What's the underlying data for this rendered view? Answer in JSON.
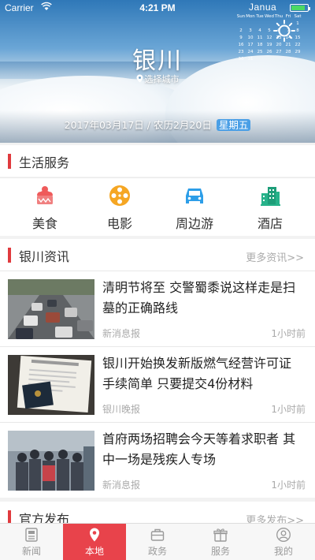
{
  "status": {
    "carrier": "Carrier",
    "time": "4:21 PM",
    "battery_level": 0.85
  },
  "hero": {
    "city": "银川",
    "choose_city": "选择城市",
    "date": "2017年03月17日",
    "lunar": "农历2月20日",
    "weekday": "星期五",
    "calendar": {
      "month": "Janua",
      "weekdays": [
        "Sun",
        "Mon",
        "Tue",
        "Wed",
        "Thu",
        "Fri",
        "Sat"
      ],
      "days": [
        "",
        "",
        "",
        "",
        "",
        "",
        "1",
        "2",
        "3",
        "4",
        "5",
        "6",
        "7",
        "8",
        "9",
        "10",
        "11",
        "12",
        "13",
        "14",
        "15",
        "16",
        "17",
        "18",
        "19",
        "20",
        "21",
        "22",
        "23",
        "24",
        "25",
        "26",
        "27",
        "28",
        "29",
        "30",
        "31"
      ]
    }
  },
  "life_services": {
    "title": "生活服务",
    "items": [
      {
        "label": "美食",
        "icon": "cake-icon",
        "color": "#ef5b5b"
      },
      {
        "label": "电影",
        "icon": "film-reel-icon",
        "color": "#f5a623"
      },
      {
        "label": "周边游",
        "icon": "car-icon",
        "color": "#2d9ee8"
      },
      {
        "label": "酒店",
        "icon": "building-icon",
        "color": "#27b28a"
      }
    ]
  },
  "local_news": {
    "title": "银川资讯",
    "more": "更多资讯>>",
    "items": [
      {
        "headline": "清明节将至 交警蜀黍说这样走是扫墓的正确路线",
        "source": "新消息报",
        "ago": "1小时前"
      },
      {
        "headline": "银川开始换发新版燃气经营许可证 手续简单 只要提交4份材料",
        "source": "银川晚报",
        "ago": "1小时前"
      },
      {
        "headline": "首府两场招聘会今天等着求职者 其中一场是残疾人专场",
        "source": "新消息报",
        "ago": "1小时前"
      }
    ]
  },
  "official": {
    "title": "官方发布",
    "more": "更多发布>>"
  },
  "tabs": [
    {
      "label": "新闻",
      "icon": "newspaper-icon",
      "active": false
    },
    {
      "label": "本地",
      "icon": "location-pin-icon",
      "active": true
    },
    {
      "label": "政务",
      "icon": "briefcase-icon",
      "active": false
    },
    {
      "label": "服务",
      "icon": "gift-icon",
      "active": false
    },
    {
      "label": "我的",
      "icon": "user-icon",
      "active": false
    }
  ],
  "colors": {
    "accent": "#e03a3e",
    "weekday_badge": "#4a9fe6"
  }
}
